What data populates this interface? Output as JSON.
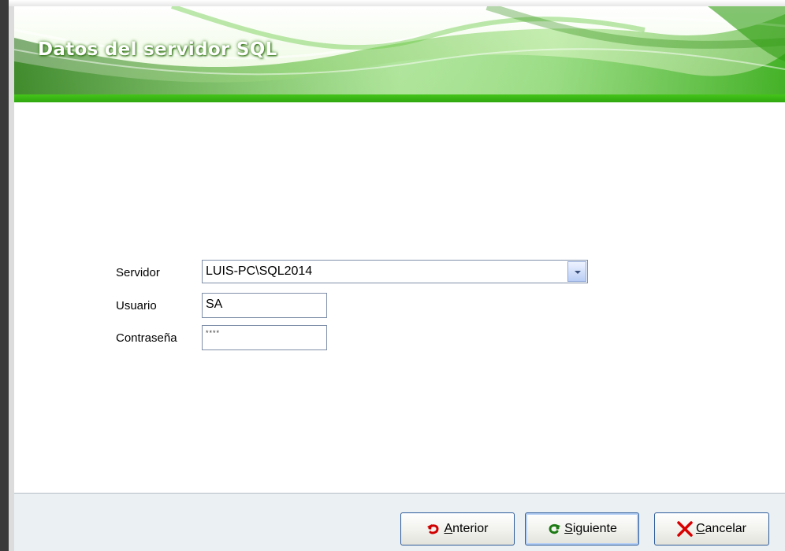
{
  "banner": {
    "title": "Datos del servidor SQL"
  },
  "form": {
    "servidor": {
      "label": "Servidor",
      "value": "LUIS-PC\\SQL2014"
    },
    "usuario": {
      "label": "Usuario",
      "value": "SA"
    },
    "contrasena": {
      "label": "Contraseña",
      "value": "****"
    }
  },
  "buttons": {
    "anterior": {
      "mnemonic": "A",
      "rest": "nterior",
      "icon": "undo-arrow-icon"
    },
    "siguiente": {
      "mnemonic": "S",
      "rest": "iguiente",
      "icon": "refresh-arrow-icon"
    },
    "cancelar": {
      "mnemonic": "C",
      "rest": "ancelar",
      "icon": "red-x-icon"
    }
  },
  "colors": {
    "accent_green": "#3cb814",
    "button_border": "#2c5a9a",
    "footer_bg": "#ebf0f2"
  }
}
